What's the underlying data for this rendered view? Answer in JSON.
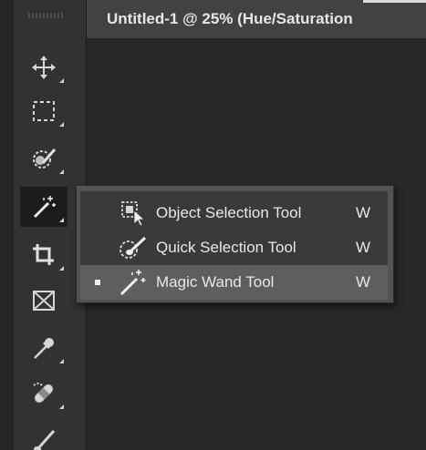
{
  "document": {
    "tab_title": "Untitled-1 @ 25% (Hue/Saturation"
  },
  "toolbar": {
    "tools": [
      {
        "name": "move-tool",
        "icon": "move-icon"
      },
      {
        "name": "rectangular-marquee-tool",
        "icon": "marquee-icon"
      },
      {
        "name": "lasso-tool",
        "icon": "lasso-icon"
      },
      {
        "name": "magic-wand-tool",
        "icon": "magic-wand-icon",
        "active": true
      },
      {
        "name": "crop-tool",
        "icon": "crop-icon"
      },
      {
        "name": "frame-tool",
        "icon": "frame-icon"
      },
      {
        "name": "eyedropper-tool",
        "icon": "eyedropper-icon"
      },
      {
        "name": "spot-healing-brush-tool",
        "icon": "bandage-icon"
      },
      {
        "name": "brush-tool",
        "icon": "brush-icon"
      }
    ]
  },
  "flyout": {
    "items": [
      {
        "label": "Object Selection Tool",
        "shortcut": "W",
        "icon": "object-selection-icon",
        "selected": false
      },
      {
        "label": "Quick Selection Tool",
        "shortcut": "W",
        "icon": "quick-selection-icon",
        "selected": false
      },
      {
        "label": "Magic Wand Tool",
        "shortcut": "W",
        "icon": "magic-wand-icon",
        "selected": true
      }
    ]
  },
  "colors": {
    "toolbar_bg": "#323232",
    "menu_bg": "#3a3a3a",
    "menu_highlight": "#5e5e5e",
    "text": "#e8e8e8"
  }
}
